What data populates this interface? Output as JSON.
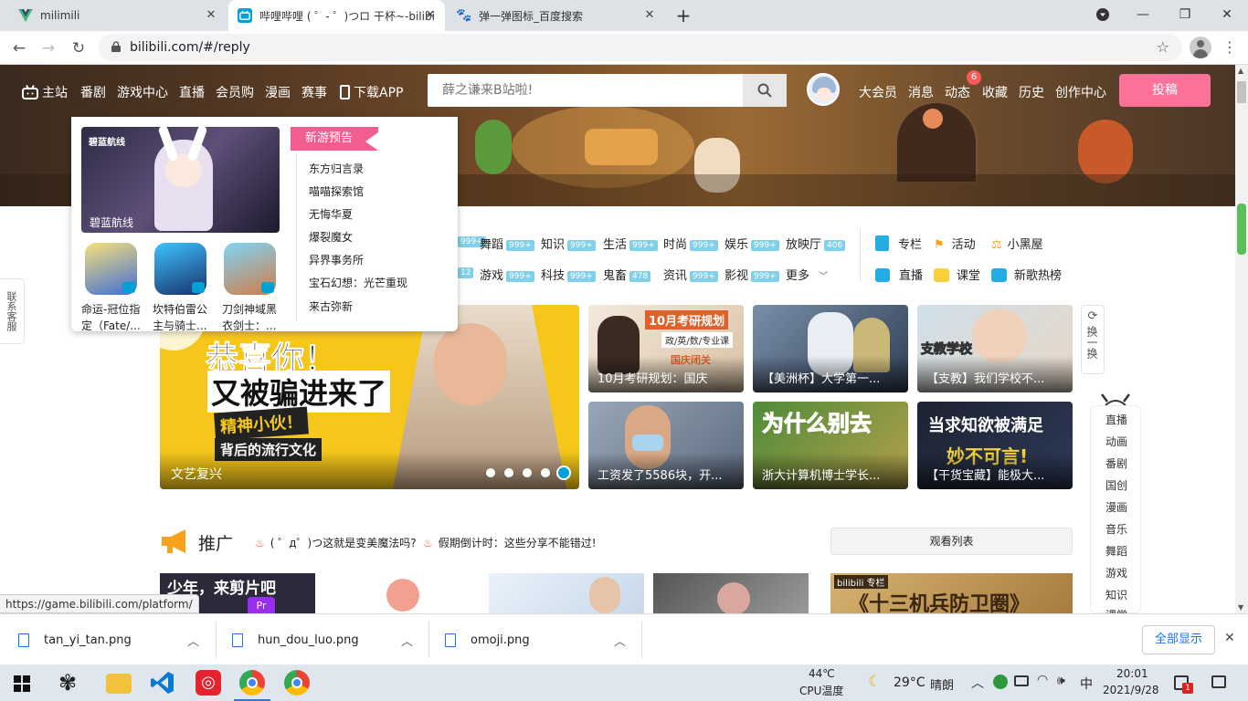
{
  "browser": {
    "tabs": [
      {
        "title": "milimili",
        "favicon": "vuejs-v-icon"
      },
      {
        "title": "哔哩哔哩 ( ゜- ゜)つロ 干杯~-bilibili",
        "favicon": "bilibili-tv-icon"
      },
      {
        "title": "弹一弹图标_百度搜索",
        "favicon": "baidu-paw-icon"
      }
    ],
    "new_tab": "+",
    "url": "bilibili.com/#/reply"
  },
  "header": {
    "nav_left": [
      "主站",
      "番剧",
      "游戏中心",
      "直播",
      "会员购",
      "漫画",
      "赛事",
      "下载APP"
    ],
    "search_placeholder": "薛之谦来B站啦!",
    "nav_right": [
      "大会员",
      "消息",
      "动态",
      "收藏",
      "历史",
      "创作中心"
    ],
    "notif_count": "6",
    "upload_label": "投稿"
  },
  "game_popup": {
    "featured_label": "碧蓝航线",
    "featured_logo_text": "碧蓝航线",
    "section_tag": "新游预告",
    "upcoming": [
      "东方归言录",
      "喵喵探索馆",
      "无悔华夏",
      "爆裂魔女",
      "异界事务所",
      "宝石幻想：光芒重现",
      "来古弥新"
    ],
    "games": [
      {
        "name": "命运-冠位指定（Fate/..."
      },
      {
        "name": "坎特伯雷公主与骑士..."
      },
      {
        "name": "刀剑神域黑衣剑士：..."
      }
    ]
  },
  "contact": "联系客服",
  "channels": {
    "row1": [
      {
        "label": "",
        "count": "999+"
      },
      {
        "label": "舞蹈",
        "count": "999+"
      },
      {
        "label": "知识",
        "count": "999+"
      },
      {
        "label": "生活",
        "count": "999+"
      },
      {
        "label": "时尚",
        "count": "999+"
      },
      {
        "label": "娱乐",
        "count": "999+"
      },
      {
        "label": "放映厅",
        "count": "406"
      }
    ],
    "row2": [
      {
        "label": "",
        "count": "12"
      },
      {
        "label": "游戏",
        "count": "999+"
      },
      {
        "label": "科技",
        "count": "999+"
      },
      {
        "label": "鬼畜",
        "count": "478"
      },
      {
        "label": "资讯",
        "count": "999+"
      },
      {
        "label": "影视",
        "count": "999+"
      },
      {
        "label": "更多",
        "count": ""
      }
    ],
    "extra": [
      "专栏",
      "活动",
      "小黑屋",
      "直播",
      "课堂",
      "新歌热榜"
    ]
  },
  "carousel": {
    "line1": "恭喜你！",
    "line2": "又被骗进来了",
    "line3": "精神小伙！",
    "line4": "背后的流行文化",
    "caption": "文艺复兴",
    "active_index": 4,
    "dot_count": 5
  },
  "cards": [
    {
      "caption": "10月考研规划：国庆",
      "overlay": "10月考研规划",
      "sub": "政/英/数/专业课",
      "extra": "国庆闭关"
    },
    {
      "caption": "【美洲杯】大学第一...",
      "overlay": "",
      "sub": "",
      "extra": ""
    },
    {
      "caption": "【支教】我们学校不...",
      "overlay": "支教学校",
      "sub": "",
      "extra": ""
    },
    {
      "caption": "工资发了5586块，开...",
      "overlay": "",
      "sub": "",
      "extra": ""
    },
    {
      "caption": "浙大计算机博士学长...",
      "overlay": "为什么别去",
      "sub": "",
      "extra": ""
    },
    {
      "caption": "【干货宝藏】能极大...",
      "overlay": "当求知欲被满足",
      "sub": "妙不可言!",
      "extra": ""
    }
  ],
  "refresh_label": "换一换",
  "promo": {
    "title": "推广",
    "hot1": "( ゜д゜)つ这就是变美魔法吗?",
    "hot2": "假期倒计时：这些分享不能错过!",
    "watchlist": "观看列表",
    "thumb1": "少年，来剪片吧",
    "thumb5_brand": "bilibili 专栏",
    "thumb5_text": "《十三机兵防卫圈》"
  },
  "float_nav": [
    "直播",
    "动画",
    "番剧",
    "国创",
    "漫画",
    "音乐",
    "舞蹈",
    "游戏",
    "知识",
    "课堂"
  ],
  "status_url": "https://game.bilibili.com/platform/",
  "downloads": [
    {
      "name": "tan_yi_tan.png"
    },
    {
      "name": "hun_dou_luo.png"
    },
    {
      "name": "omoji.png"
    }
  ],
  "download_all": "全部显示",
  "taskbar": {
    "cpu_temp": "44℃",
    "cpu_label": "CPU温度",
    "weather": "29°C",
    "weather_text": "晴朗",
    "ime": "中",
    "time": "20:01",
    "date": "2021/9/28",
    "notif_badge": "1"
  },
  "colors": {
    "accent_pink": "#fb7299",
    "bili_blue": "#00a1d6",
    "count_badge": "#7fd0e8"
  }
}
